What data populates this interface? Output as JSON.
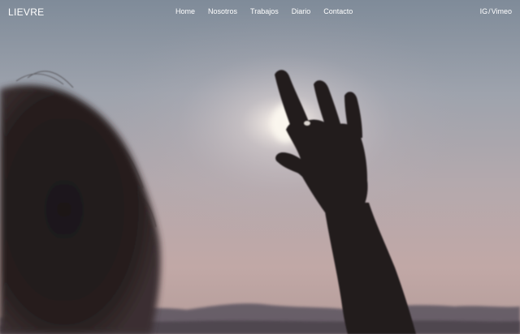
{
  "brand": {
    "name": "LIEVRE"
  },
  "nav": {
    "items": [
      {
        "label": "Home"
      },
      {
        "label": "Nosotros"
      },
      {
        "label": "Trabajos"
      },
      {
        "label": "Diario"
      },
      {
        "label": "Contacto"
      }
    ]
  },
  "social": {
    "instagram": "IG",
    "separator": "/",
    "vimeo": "Vimeo"
  },
  "hero": {
    "image": "sunset-hand-silhouette",
    "colors": {
      "sky_top": "#8c9aa6",
      "sky_mid": "#b7aaab",
      "sky_low": "#c2a9a5",
      "sun": "#fbf7f0",
      "mountains": "#5f5660",
      "silhouette": "#1f1a1b"
    }
  }
}
